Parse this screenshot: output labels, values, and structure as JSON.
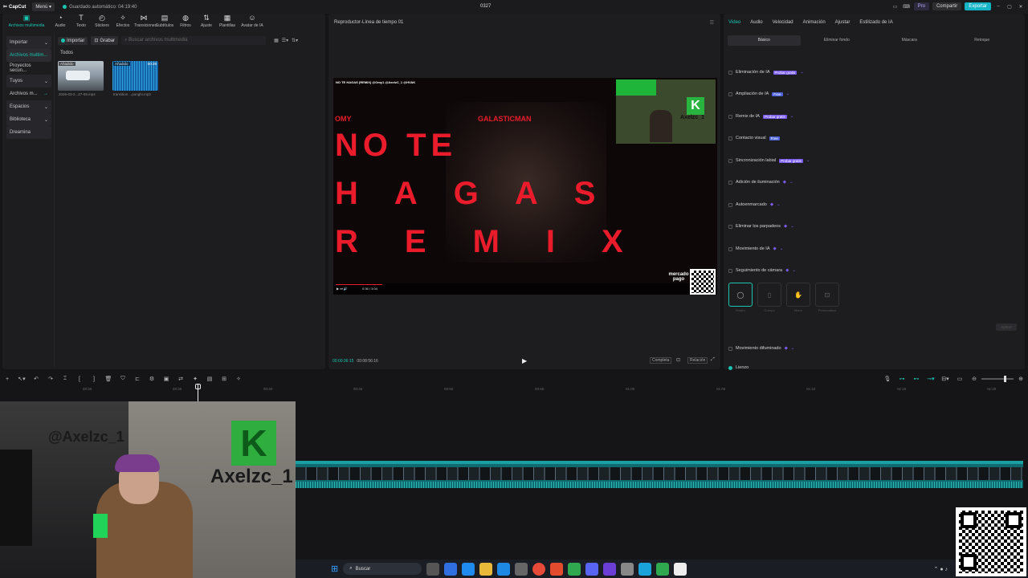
{
  "app": {
    "name": "CapCut",
    "menu_label": "Menú",
    "autosave": "Guardado automático: 04:19:40",
    "project_name": "0327",
    "pro_label": "Pro",
    "share_label": "Compartir",
    "export_label": "Exportar"
  },
  "media_tabs": [
    {
      "label": "Archivos multimedia",
      "icon": "media-icon"
    },
    {
      "label": "Audio",
      "icon": "audio-icon"
    },
    {
      "label": "Texto",
      "icon": "text-icon"
    },
    {
      "label": "Stickers",
      "icon": "sticker-icon"
    },
    {
      "label": "Efectos",
      "icon": "effects-icon"
    },
    {
      "label": "Transiciones",
      "icon": "transitions-icon"
    },
    {
      "label": "Subtítulos",
      "icon": "subtitles-icon"
    },
    {
      "label": "Filtros",
      "icon": "filters-icon"
    },
    {
      "label": "Ajuste",
      "icon": "adjust-icon"
    },
    {
      "label": "Plantillas",
      "icon": "templates-icon"
    },
    {
      "label": "Avatar de IA",
      "icon": "avatar-icon"
    }
  ],
  "sidenav": [
    {
      "label": "Importar"
    },
    {
      "label": "Archivos multim..."
    },
    {
      "label": "Proyectos secun..."
    },
    {
      "label": "Tuyos"
    },
    {
      "label": "Archivos m..."
    },
    {
      "label": "Espacios"
    },
    {
      "label": "Biblioteca"
    },
    {
      "label": "Dreamina"
    }
  ],
  "media": {
    "import_label": "Importar",
    "record_label": "Grabar",
    "search_placeholder": "Buscar archivos multimedia",
    "filter_all": "Todos",
    "added_badge": "Añadido",
    "items": [
      {
        "name": "2026-03-2...27-09.mp4"
      },
      {
        "name": "transition ...punghi.mp3",
        "duration": "00:28"
      }
    ]
  },
  "player": {
    "title": "Reproductor-Línea de tiempo 01",
    "current_time": "00:00:36:15",
    "total_time": "00:08:56:16",
    "quality_label": "Completa",
    "ratio_label": "Relación",
    "video_overlay": {
      "caption": "NO TE HAGAS (REMIX) @Omy1 @AxelzC_1 @HVAK",
      "credit_left": "OMY",
      "credit_right": "GALASTICMAN",
      "lines": [
        "NO TE",
        "HAGAS",
        "REMIX"
      ],
      "webcam_name": "Axelzc_1",
      "sponsor": "mercado pago",
      "player_time": "0:36 / 3:04"
    }
  },
  "inspector": {
    "tabs": [
      "Video",
      "Audio",
      "Velocidad",
      "Animación",
      "Ajustar",
      "Estilizado de IA"
    ],
    "subtabs": [
      "Básico",
      "Eliminar fondo",
      "Máscara",
      "Retoque"
    ],
    "features": [
      {
        "label": "Eliminación de IA",
        "tag": "Probar gratis"
      },
      {
        "label": "Ampliación de IA",
        "tag": "Free"
      },
      {
        "label": "Remix de IA",
        "tag": "Probar gratis"
      },
      {
        "label": "Contacto visual",
        "tag": "Free"
      },
      {
        "label": "Sincronización labial",
        "tag": "Probar gratis"
      },
      {
        "label": "Adición de iluminación",
        "tag": ""
      },
      {
        "label": "Autoenmarcado",
        "tag": ""
      },
      {
        "label": "Eliminar los parpadeos",
        "tag": ""
      },
      {
        "label": "Movimiento de IA",
        "tag": ""
      },
      {
        "label": "Seguimiento de cámara",
        "tag": ""
      },
      {
        "label": "Movimiento difuminado",
        "tag": ""
      }
    ],
    "camera_options": [
      "Rostro",
      "Cuerpo",
      "Mano",
      "Personalizar"
    ],
    "apply_label": "Aplicar",
    "bottom_label": "Lienzo"
  },
  "timeline": {
    "ruler": [
      "00:30",
      "00:35",
      "00:40",
      "00:45",
      "00:50",
      "00:55",
      "01:00",
      "01:05",
      "01:10",
      "01:15",
      "01:20"
    ]
  },
  "webcam_overlay": {
    "handle": "@Axelzc_1",
    "brand": "Axelzc_1",
    "logo_letter": "K"
  },
  "taskbar": {
    "search_label": "Buscar"
  },
  "colors": {
    "accent": "#19c4b1",
    "export": "#15b3c6",
    "video_red": "#ea1c2b",
    "tag_purple": "#7b5cf0"
  }
}
